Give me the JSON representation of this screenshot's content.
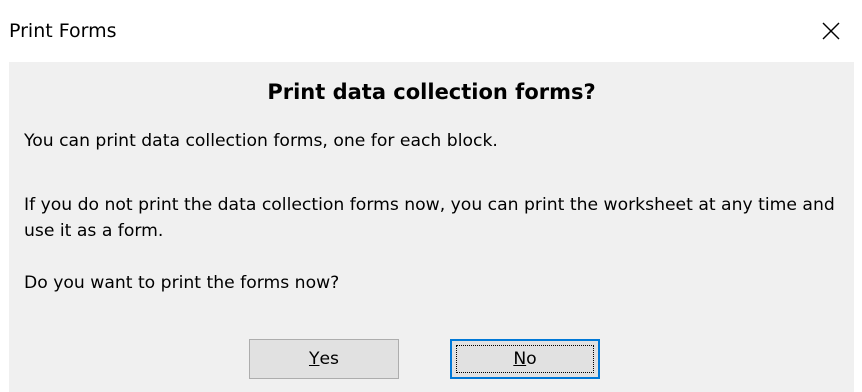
{
  "window": {
    "title": "Print Forms",
    "close_icon": "close-icon"
  },
  "content": {
    "heading": "Print data collection forms?",
    "paragraph1": "You can print data collection forms, one for each block.",
    "paragraph2": "If you do not print the data collection forms now, you can print the worksheet at any time and use it as a form.",
    "paragraph3": "Do you want to print the forms now?"
  },
  "buttons": {
    "yes": {
      "mnemonic": "Y",
      "rest": "es"
    },
    "no": {
      "mnemonic": "N",
      "rest": "o"
    }
  },
  "colors": {
    "client_background": "#f0f0f0",
    "focus_border": "#0078d7"
  }
}
